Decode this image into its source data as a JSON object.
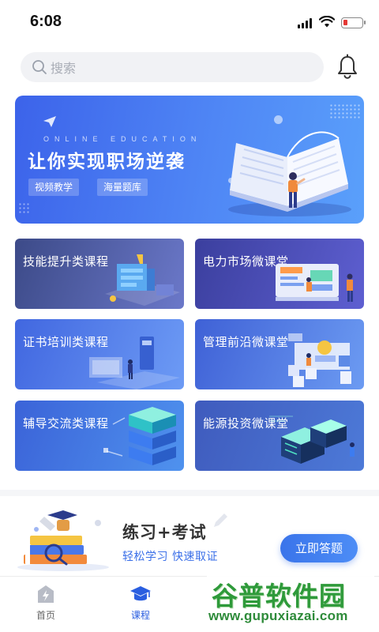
{
  "status_bar": {
    "time": "6:08"
  },
  "search": {
    "placeholder": "搜索"
  },
  "banner": {
    "subtitle": "ONLINE EDUCATION",
    "title": "让你实现职场逆袭",
    "tags": [
      "视频教学",
      "海量题库"
    ]
  },
  "courses": [
    {
      "label": "技能提升类课程"
    },
    {
      "label": "电力市场微课堂"
    },
    {
      "label": "证书培训类课程"
    },
    {
      "label": "管理前沿微课堂"
    },
    {
      "label": "辅导交流类课程"
    },
    {
      "label": "能源投资微课堂"
    }
  ],
  "practice": {
    "title": "练习+考试",
    "subtitle": "轻松学习  快速取证",
    "button": "立即答题"
  },
  "tab_bar": {
    "items": [
      {
        "label": "首页",
        "icon": "home-icon"
      },
      {
        "label": "课程",
        "icon": "graduation-cap-icon"
      }
    ],
    "active_color": "#2a5ee0"
  },
  "watermark": {
    "title": "谷普软件园",
    "url": "www.gupuxiazai.com"
  },
  "colors": {
    "accent": "#3a74ea",
    "battery_low": "#e53935"
  }
}
